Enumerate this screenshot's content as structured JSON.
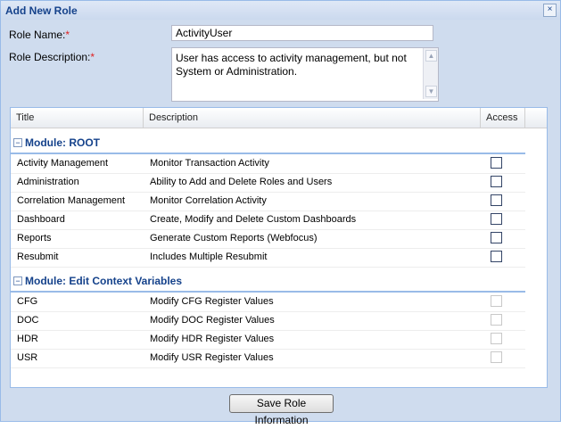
{
  "dialog": {
    "title": "Add New Role",
    "close_label": "×"
  },
  "form": {
    "role_name_label": "Role Name:",
    "role_name_value": "ActivityUser",
    "role_desc_label": "Role Description:",
    "role_desc_value": "User has access to activity management, but not System or Administration.",
    "required_mark": "*"
  },
  "grid": {
    "columns": [
      "Title",
      "Description",
      "Access"
    ],
    "groups": [
      {
        "title": "Module: ROOT",
        "toggle": "−",
        "rows": [
          {
            "title": "Activity Management",
            "desc": "Monitor Transaction Activity"
          },
          {
            "title": "Administration",
            "desc": "Ability to Add and Delete Roles and Users"
          },
          {
            "title": "Correlation Management",
            "desc": "Monitor Correlation Activity"
          },
          {
            "title": "Dashboard",
            "desc": "Create, Modify and Delete Custom Dashboards"
          },
          {
            "title": "Reports",
            "desc": "Generate Custom Reports (Webfocus)"
          },
          {
            "title": "Resubmit",
            "desc": "Includes Multiple Resubmit"
          }
        ]
      },
      {
        "title": "Module: Edit Context Variables",
        "toggle": "−",
        "rows": [
          {
            "title": "CFG",
            "desc": "Modify CFG Register Values"
          },
          {
            "title": "DOC",
            "desc": "Modify DOC Register Values"
          },
          {
            "title": "HDR",
            "desc": "Modify HDR Register Values"
          },
          {
            "title": "USR",
            "desc": "Modify USR Register Values"
          }
        ]
      }
    ]
  },
  "buttons": {
    "save_label": "Save Role Information"
  },
  "icons": {
    "scroll_up": "▲",
    "scroll_down": "▼"
  }
}
